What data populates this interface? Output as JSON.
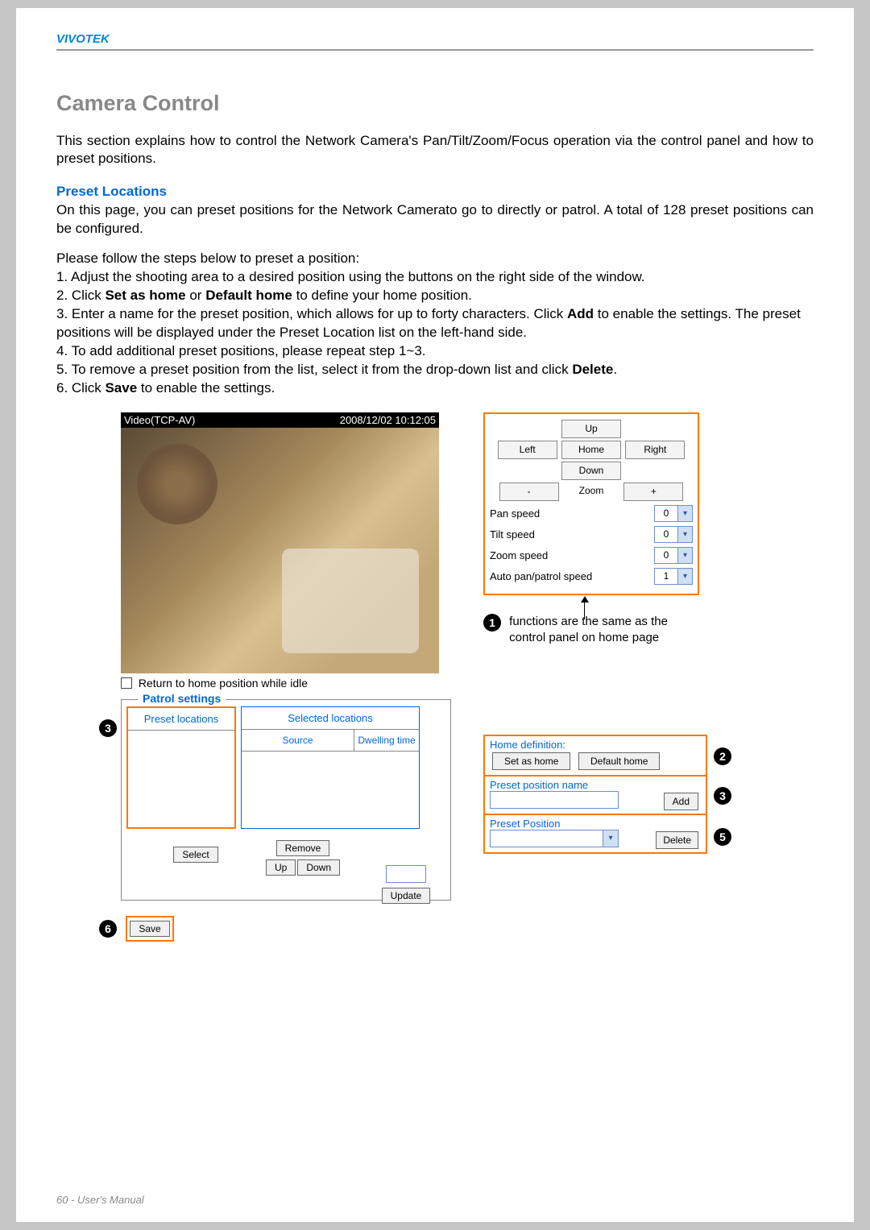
{
  "header": {
    "brand": "VIVOTEK"
  },
  "title": "Camera Control",
  "intro": "This section explains how to control the Network Camera's Pan/Tilt/Zoom/Focus operation via the control panel and how to preset positions.",
  "preset": {
    "heading": "Preset Locations",
    "para": "On this page, you can preset positions for the Network Camerato go to directly or patrol. A total of 128 preset positions can be configured.",
    "lead": "Please follow the steps below to preset a position:",
    "s1": "1. Adjust the shooting area to a desired position using the buttons on the right side of the window.",
    "s2a": "2. Click ",
    "s2_home": "Set as home",
    "s2b": " or ",
    "s2_dhome": "Default home",
    "s2c": " to define your home position.",
    "s3a": "3. Enter a name for the preset position, which allows for up to forty characters. Click ",
    "s3_add": "Add",
    "s3b": " to enable the settings. The preset positions will be displayed under the Preset Location list on the left-hand side.",
    "s4": "4. To add additional preset positions, please repeat step 1~3.",
    "s5a": "5. To remove a preset position from the list, select it from the drop-down list and click ",
    "s5_del": "Delete",
    "s5b": ".",
    "s6a": "6. Click ",
    "s6_save": "Save",
    "s6b": " to enable the settings."
  },
  "video": {
    "stream": "Video(TCP-AV)",
    "timestamp": "2008/12/02 10:12:05"
  },
  "controls": {
    "up": "Up",
    "left": "Left",
    "home": "Home",
    "right": "Right",
    "down": "Down",
    "minus": "-",
    "zoom": "Zoom",
    "plus": "+",
    "pan_speed": "Pan speed",
    "tilt_speed": "Tilt speed",
    "zoom_speed": "Zoom speed",
    "auto_speed": "Auto pan/patrol speed",
    "pan_val": "0",
    "tilt_val": "0",
    "zoom_val": "0",
    "auto_val": "1"
  },
  "note1": "functions are the same as the control panel on  home page",
  "checkbox_label": "Return to home position while idle",
  "patrol": {
    "legend": "Patrol settings",
    "preset_locations": "Preset locations",
    "selected_locations": "Selected locations",
    "source": "Source",
    "dwelling": "Dwelling time",
    "select": "Select",
    "remove": "Remove",
    "up": "Up",
    "down": "Down",
    "update": "Update"
  },
  "home_def": {
    "label": "Home definition:",
    "set": "Set as home",
    "def": "Default home",
    "preset_name_label": "Preset position name",
    "add": "Add",
    "preset_pos_label": "Preset Position",
    "delete": "Delete"
  },
  "save": "Save",
  "callouts": {
    "n1": "1",
    "n2": "2",
    "n3": "3",
    "n5": "5",
    "n6": "6"
  },
  "footer": "60 - User's Manual"
}
